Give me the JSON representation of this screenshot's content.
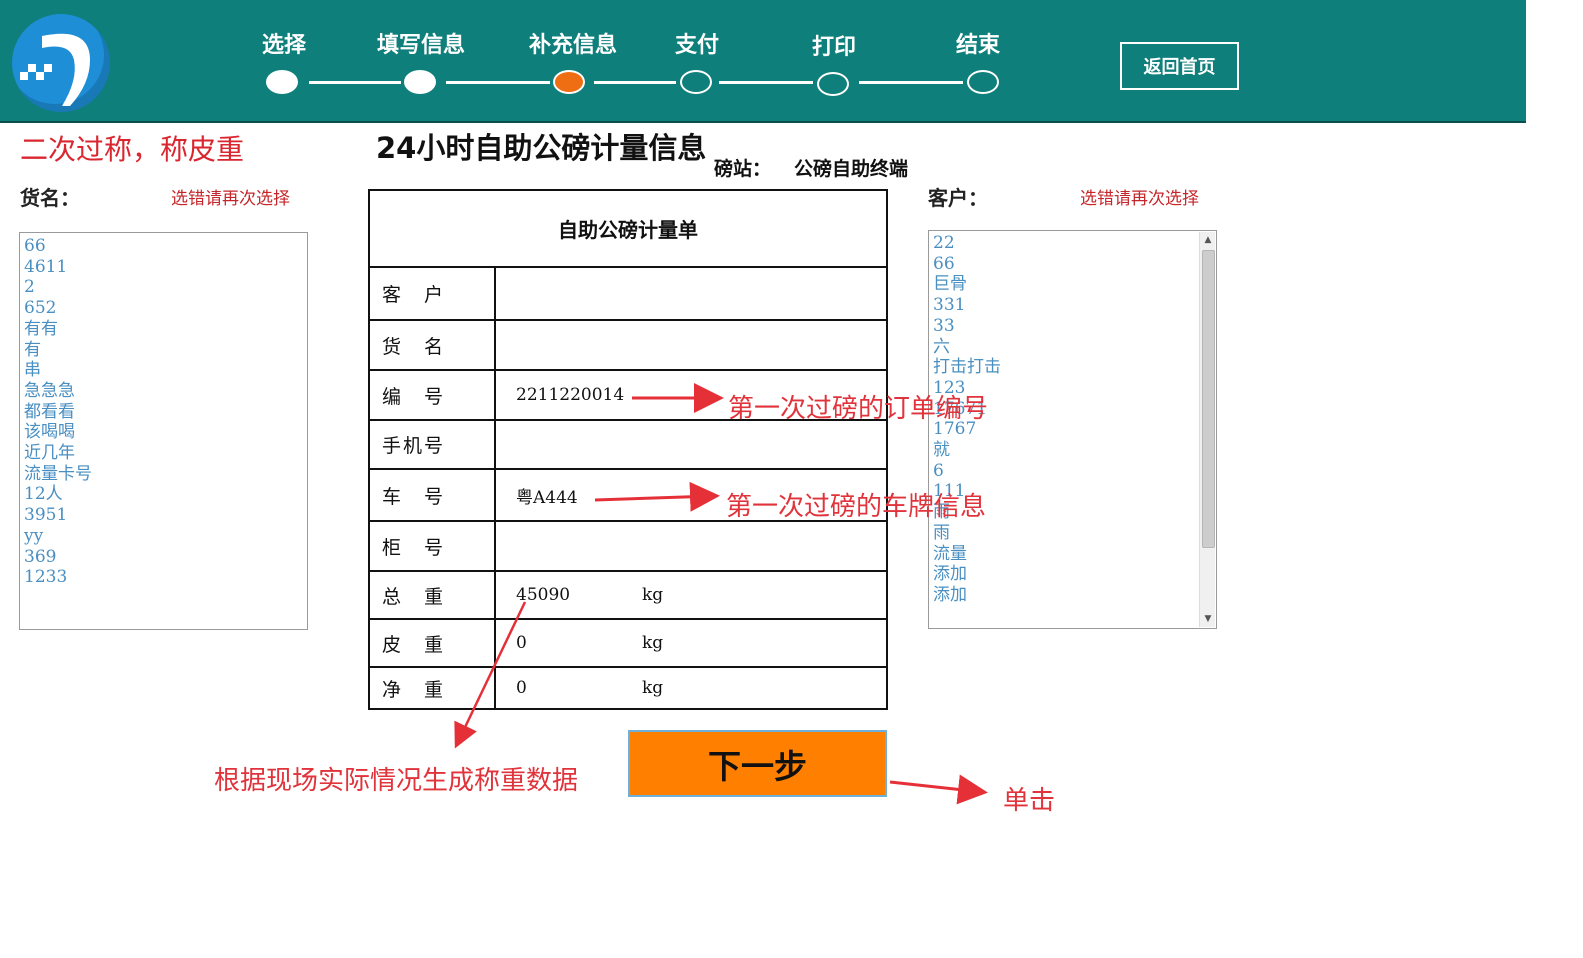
{
  "header": {
    "steps": [
      {
        "label": "选择",
        "state": "done"
      },
      {
        "label": "填写信息",
        "state": "done"
      },
      {
        "label": "补充信息",
        "state": "current"
      },
      {
        "label": "支付",
        "state": "todo"
      },
      {
        "label": "打印",
        "state": "todo"
      },
      {
        "label": "结束",
        "state": "todo"
      }
    ],
    "home_button": "返回首页",
    "logo_icon": "road-logo-icon"
  },
  "left": {
    "page_heading": "二次过称，称皮重",
    "goods_label": "货名：",
    "goods_hint": "选错请再次选择",
    "goods_options": [
      "66",
      "4611",
      "2",
      "652",
      "有有",
      "有",
      "串",
      "急急急",
      "都看看",
      "该喝喝",
      "近几年",
      "流量卡号",
      "12人",
      "3951",
      "yy",
      "369",
      "1233"
    ]
  },
  "center": {
    "title": "24小时自助公磅计量信息",
    "station_label": "磅站：",
    "station_value": "公磅自助终端",
    "form_title": "自助公磅计量单",
    "rows": {
      "customer": {
        "label": "客　户",
        "value": ""
      },
      "goods": {
        "label": "货　名",
        "value": ""
      },
      "number": {
        "label": "编　号",
        "value": "2211220014"
      },
      "phone": {
        "label": "手机号",
        "value": ""
      },
      "plate": {
        "label": "车　号",
        "value": "粤A444"
      },
      "cabinet": {
        "label": "柜　号",
        "value": ""
      },
      "gross": {
        "label": "总　重",
        "value": "45090",
        "unit": "kg"
      },
      "tare": {
        "label": "皮　重",
        "value": "0",
        "unit": "kg"
      },
      "net": {
        "label": "净　重",
        "value": "0",
        "unit": "kg"
      }
    },
    "next_button": "下一步"
  },
  "right": {
    "customer_label": "客户：",
    "customer_hint": "选错请再次选择",
    "customer_options": [
      "22",
      "66",
      "巨骨",
      "331",
      "33",
      "六",
      "打击打击",
      "123",
      "17671",
      "1767",
      "就",
      "6",
      "111",
      "雨",
      "雨",
      "流量",
      "添加",
      "添加"
    ]
  },
  "annotations": {
    "order_number": "第一次过磅的订单编号",
    "plate_info": "第一次过磅的车牌信息",
    "weight_data": "根据现场实际情况生成称重数据",
    "click": "单击"
  },
  "colors": {
    "header_bg": "#0f7f7b",
    "current_step": "#ef6d13",
    "next_button_bg": "#ff8000",
    "annotation_red": "#e0333b",
    "list_text": "#4a8fc2"
  }
}
